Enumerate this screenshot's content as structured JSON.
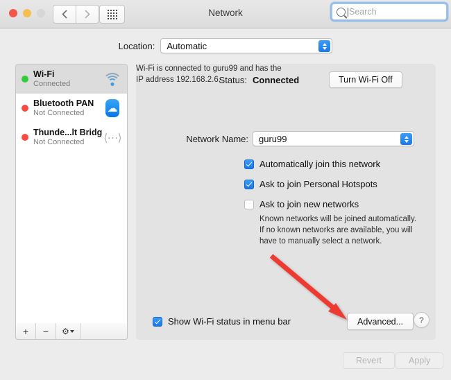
{
  "window": {
    "title": "Network",
    "traffic_lights": [
      "close",
      "minimize",
      "zoom-disabled"
    ],
    "nav_back_icon": "chevron-left-icon",
    "nav_forward_icon": "chevron-right-icon",
    "grid_icon": "show-all-preferences-icon"
  },
  "search": {
    "placeholder": "Search",
    "icon": "search-icon",
    "value": ""
  },
  "location": {
    "label": "Location:",
    "selected": "Automatic"
  },
  "sidebar": {
    "services": [
      {
        "name": "Wi-Fi",
        "status": "Connected",
        "dot": "green",
        "icon": "wifi-icon",
        "selected": true
      },
      {
        "name": "Bluetooth PAN",
        "status": "Not Connected",
        "dot": "red",
        "icon": "bluetooth-icon",
        "selected": false
      },
      {
        "name": "Thunde...lt Bridge",
        "status": "Not Connected",
        "dot": "red",
        "icon": "thunderbolt-bridge-icon",
        "selected": false
      }
    ],
    "footer": {
      "add_label": "+",
      "remove_label": "−",
      "gear_label": "⚙"
    }
  },
  "main": {
    "status_label": "Status:",
    "status_value": "Connected",
    "status_description": "Wi-Fi is connected to guru99 and has the IP address 192.168.2.6.",
    "turn_off_button": "Turn Wi-Fi Off",
    "network_name_label": "Network Name:",
    "network_name_value": "guru99",
    "checkboxes": [
      {
        "label": "Automatically join this network",
        "checked": true
      },
      {
        "label": "Ask to join Personal Hotspots",
        "checked": true
      },
      {
        "label": "Ask to join new networks",
        "checked": false
      }
    ],
    "hint": "Known networks will be joined automatically. If no known networks are available, you will have to manually select a network.",
    "menu_bar_checkbox": {
      "label": "Show Wi-Fi status in menu bar",
      "checked": true
    },
    "advanced_button": "Advanced...",
    "help_button": "?"
  },
  "footer": {
    "revert_button": "Revert",
    "apply_button": "Apply"
  },
  "annotation": {
    "type": "red-arrow",
    "color": "#ee3b33",
    "points_to": "Advanced..."
  }
}
